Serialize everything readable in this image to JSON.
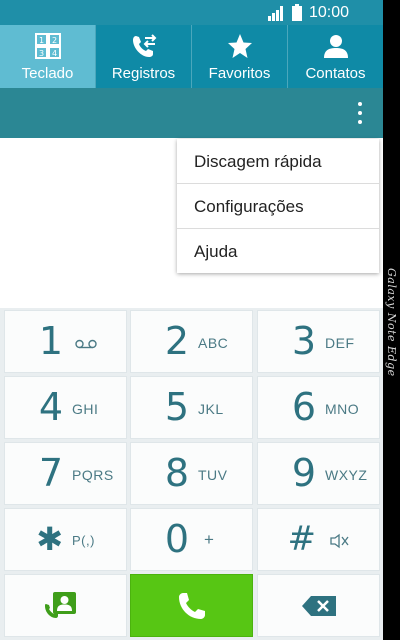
{
  "status_bar": {
    "time": "10:00"
  },
  "tabs": [
    {
      "label": "Teclado",
      "icon": "keypad-icon",
      "active": true
    },
    {
      "label": "Registros",
      "icon": "call-log-icon",
      "active": false
    },
    {
      "label": "Favoritos",
      "icon": "star-icon",
      "active": false
    },
    {
      "label": "Contatos",
      "icon": "contact-icon",
      "active": false
    }
  ],
  "menu": {
    "items": [
      "Discagem rápida",
      "Configurações",
      "Ajuda"
    ]
  },
  "keypad": {
    "keys": [
      {
        "digit": "1",
        "letters": ""
      },
      {
        "digit": "2",
        "letters": "ABC"
      },
      {
        "digit": "3",
        "letters": "DEF"
      },
      {
        "digit": "4",
        "letters": "GHI"
      },
      {
        "digit": "5",
        "letters": "JKL"
      },
      {
        "digit": "6",
        "letters": "MNO"
      },
      {
        "digit": "7",
        "letters": "PQRS"
      },
      {
        "digit": "8",
        "letters": "TUV"
      },
      {
        "digit": "9",
        "letters": "WXYZ"
      },
      {
        "digit": "✱",
        "letters": "P(,)"
      },
      {
        "digit": "0",
        "letters": "+"
      },
      {
        "digit": "#",
        "letters": ""
      }
    ]
  },
  "bezel_text": "Galaxy Note Edge",
  "colors": {
    "accent": "#0f8aa6",
    "active_tab": "#5fbcd2",
    "action_bar": "#2b8794",
    "call_green": "#57c614",
    "digit_color": "#2e7280"
  }
}
